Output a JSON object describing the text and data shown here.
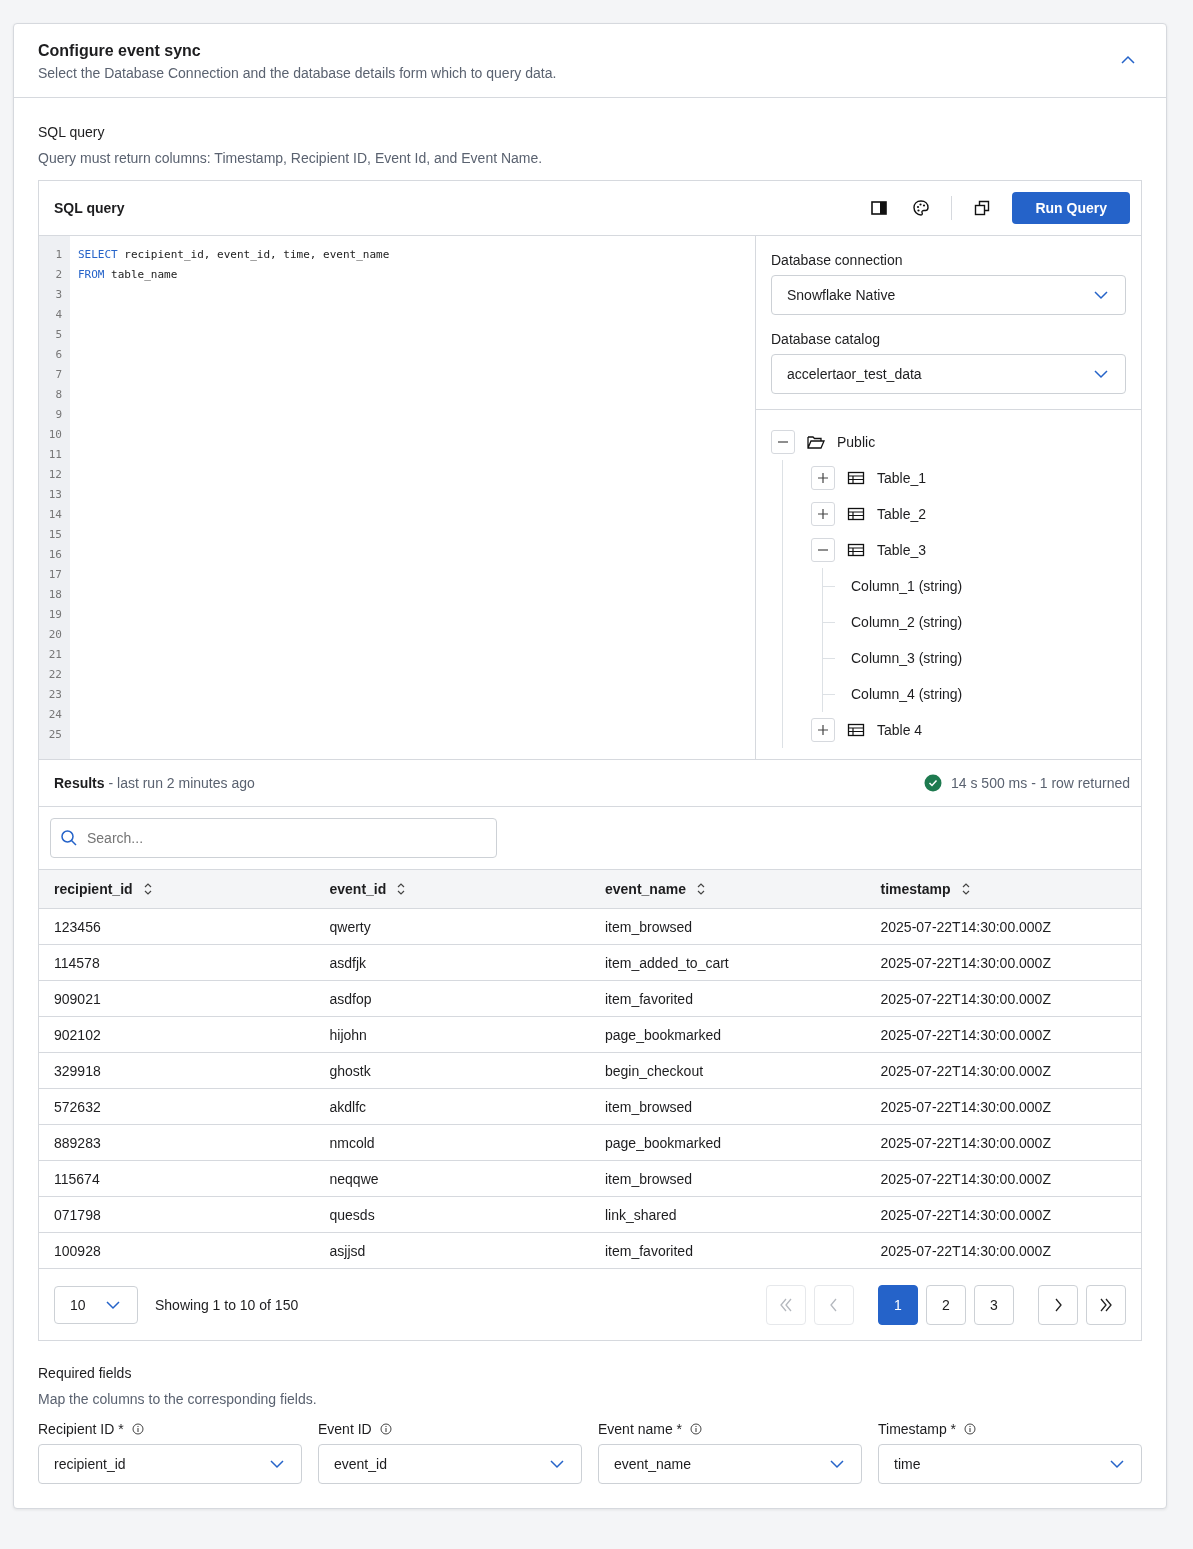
{
  "section": {
    "title": "Configure event sync",
    "subtitle": "Select the Database Connection and the database details form which to query data.",
    "expanded": true
  },
  "sql": {
    "label": "SQL query",
    "hint": "Query must return columns: Timestamp, Recipient ID, Event Id, and Event Name.",
    "panel_title": "SQL query",
    "run_button": "Run Query",
    "lines": [
      {
        "number": "1",
        "keyword": "SELECT",
        "text": " recipient_id, event_id, time, event_name"
      },
      {
        "number": "2",
        "keyword": "FROM",
        "text": " table_name"
      },
      {
        "number": "3"
      },
      {
        "number": "4"
      },
      {
        "number": "5"
      },
      {
        "number": "6"
      },
      {
        "number": "7"
      },
      {
        "number": "8"
      },
      {
        "number": "9"
      },
      {
        "number": "10"
      },
      {
        "number": "11"
      },
      {
        "number": "12"
      },
      {
        "number": "13"
      },
      {
        "number": "14"
      },
      {
        "number": "15"
      },
      {
        "number": "16"
      },
      {
        "number": "17"
      },
      {
        "number": "18"
      },
      {
        "number": "19"
      },
      {
        "number": "20"
      },
      {
        "number": "21"
      },
      {
        "number": "22"
      },
      {
        "number": "23"
      },
      {
        "number": "24"
      },
      {
        "number": "25"
      }
    ]
  },
  "database": {
    "connection_label": "Database connection",
    "connection_value": "Snowflake Native",
    "catalog_label": "Database catalog",
    "catalog_value": "accelertaor_test_data",
    "tree": [
      {
        "label": "Public",
        "kind": "folder",
        "expanded": true,
        "children": [
          {
            "label": "Table_1",
            "kind": "table",
            "expanded": false
          },
          {
            "label": "Table_2",
            "kind": "table",
            "expanded": false
          },
          {
            "label": "Table_3",
            "kind": "table",
            "expanded": true,
            "children": [
              {
                "label": "Column_1 (string)",
                "kind": "column"
              },
              {
                "label": "Column_2 (string)",
                "kind": "column"
              },
              {
                "label": "Column_3 (string)",
                "kind": "column"
              },
              {
                "label": "Column_4 (string)",
                "kind": "column"
              }
            ]
          },
          {
            "label": "Table 4",
            "kind": "table",
            "expanded": false
          }
        ]
      }
    ]
  },
  "results": {
    "title": "Results",
    "subtitle": " - last run 2 minutes ago",
    "status": "14 s 500 ms - 1 row returned",
    "search_placeholder": "Search...",
    "columns": [
      "recipient_id",
      "event_id",
      "event_name",
      "timestamp"
    ],
    "rows": [
      [
        "123456",
        "qwerty",
        "item_browsed",
        "2025-07-22T14:30:00.000Z"
      ],
      [
        "114578",
        "asdfjk",
        "item_added_to_cart",
        "2025-07-22T14:30:00.000Z"
      ],
      [
        "909021",
        "asdfop",
        "item_favorited",
        "2025-07-22T14:30:00.000Z"
      ],
      [
        "902102",
        "hijohn",
        "page_bookmarked",
        "2025-07-22T14:30:00.000Z"
      ],
      [
        "329918",
        "ghostk",
        "begin_checkout",
        "2025-07-22T14:30:00.000Z"
      ],
      [
        "572632",
        "akdlfc",
        "item_browsed",
        "2025-07-22T14:30:00.000Z"
      ],
      [
        "889283",
        "nmcold",
        "page_bookmarked",
        "2025-07-22T14:30:00.000Z"
      ],
      [
        "115674",
        "neqqwe",
        "item_browsed",
        "2025-07-22T14:30:00.000Z"
      ],
      [
        "071798",
        "quesds",
        "link_shared",
        "2025-07-22T14:30:00.000Z"
      ],
      [
        "100928",
        "asjjsd",
        "item_favorited",
        "2025-07-22T14:30:00.000Z"
      ]
    ],
    "page_size": "10",
    "showing": "Showing 1 to 10 of 150",
    "first_disabled": true,
    "prev_disabled": true,
    "next_disabled": false,
    "last_disabled": false,
    "pages": [
      {
        "label": "1",
        "selected": true
      },
      {
        "label": "2",
        "selected": false
      },
      {
        "label": "3",
        "selected": false
      }
    ]
  },
  "required": {
    "title": "Required fields",
    "hint": "Map the columns to the corresponding fields.",
    "fields": [
      {
        "label": "Recipient ID *",
        "value": "recipient_id"
      },
      {
        "label": "Event ID",
        "value": "event_id"
      },
      {
        "label": "Event name *",
        "value": "event_name"
      },
      {
        "label": "Timestamp *",
        "value": "time"
      }
    ]
  }
}
